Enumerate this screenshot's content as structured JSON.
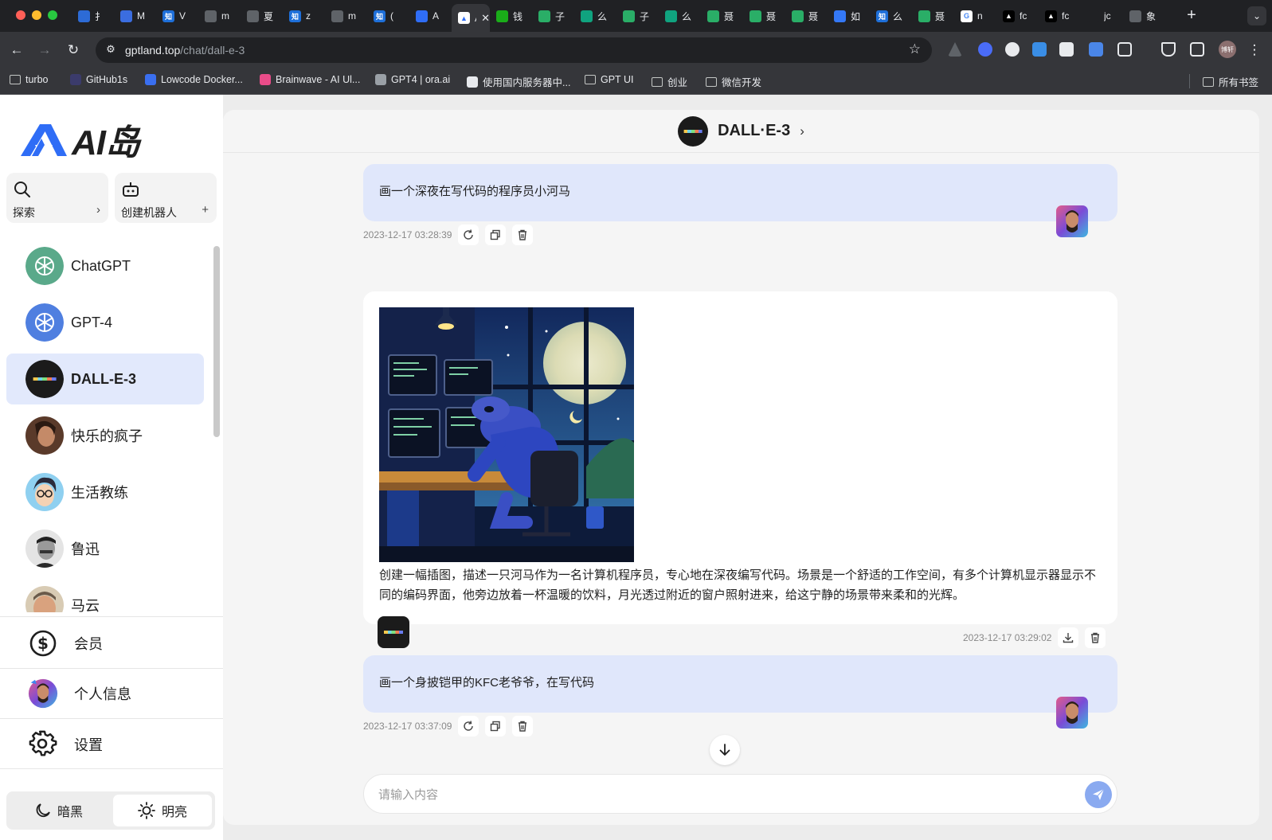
{
  "browser": {
    "tabs": [
      {
        "title": "扌",
        "color": "#2d6bd6",
        "glyph": ""
      },
      {
        "title": "M",
        "color": "#3b6de0",
        "glyph": ""
      },
      {
        "title": "V",
        "color": "#1e6fd9",
        "glyph": "知"
      },
      {
        "title": "m",
        "color": "#5f6368",
        "glyph": ""
      },
      {
        "title": "夏",
        "color": "#5f6368",
        "glyph": ""
      },
      {
        "title": "z",
        "color": "#1e6fd9",
        "glyph": "知"
      },
      {
        "title": "m",
        "color": "#5f6368",
        "glyph": ""
      },
      {
        "title": "(",
        "color": "#1e6fd9",
        "glyph": "知"
      },
      {
        "title": "A",
        "color": "#2f6df6",
        "glyph": ""
      }
    ],
    "active_tab": {
      "title": "A",
      "close": "✕"
    },
    "tabs_right": [
      {
        "title": "钱",
        "color": "#1aad19",
        "glyph": ""
      },
      {
        "title": "子",
        "color": "#2aae67",
        "glyph": ""
      },
      {
        "title": "么",
        "color": "#10a37f",
        "glyph": ""
      },
      {
        "title": "子",
        "color": "#2aae67",
        "glyph": ""
      },
      {
        "title": "么",
        "color": "#10a37f",
        "glyph": ""
      },
      {
        "title": "聂",
        "color": "#2aae67",
        "glyph": ""
      },
      {
        "title": "聂",
        "color": "#2aae67",
        "glyph": ""
      },
      {
        "title": "聂",
        "color": "#2aae67",
        "glyph": ""
      },
      {
        "title": "如",
        "color": "#3478f6",
        "glyph": ""
      },
      {
        "title": "么",
        "color": "#1e6fd9",
        "glyph": "知"
      },
      {
        "title": "聂",
        "color": "#2aae67",
        "glyph": ""
      },
      {
        "title": "n",
        "color": "#ffffff",
        "glyph": "G"
      },
      {
        "title": "fc",
        "color": "#000000",
        "glyph": "▲"
      },
      {
        "title": "fc",
        "color": "#000000",
        "glyph": "▲"
      },
      {
        "title": "jc",
        "color": "#202124",
        "glyph": ""
      },
      {
        "title": "象",
        "color": "#5f6368",
        "glyph": ""
      }
    ],
    "new_tab": "+",
    "url_host": "gptland.top",
    "url_path": "/chat/dall-e-3",
    "profile_label": "博轩",
    "bookmarks": [
      {
        "label": "turbo",
        "type": "folder"
      },
      {
        "label": "GitHub1s",
        "type": "site",
        "color": "#3b3b6b"
      },
      {
        "label": "Lowcode Docker...",
        "type": "site",
        "color": "#3a6ff0"
      },
      {
        "label": "Brainwave - AI Ul...",
        "type": "site",
        "color": "#e94c89"
      },
      {
        "label": "GPT4 | ora.ai",
        "type": "site",
        "color": "#9aa0a6"
      },
      {
        "label": "使用国内服务器中...",
        "type": "site",
        "color": "#e8eaed"
      },
      {
        "label": "GPT UI",
        "type": "folder"
      },
      {
        "label": "创业",
        "type": "folder"
      },
      {
        "label": "微信开发",
        "type": "folder"
      }
    ],
    "all_bookmarks": "所有书签"
  },
  "sidebar": {
    "brand": "AI岛",
    "explore": {
      "label": "探索",
      "arrow": "›"
    },
    "create": {
      "label": "创建机器人",
      "plus": "+"
    },
    "bots": [
      {
        "name": "ChatGPT",
        "avatar": "openai-green"
      },
      {
        "name": "GPT-4",
        "avatar": "openai-blue"
      },
      {
        "name": "DALL-E-3",
        "avatar": "dalle",
        "active": true
      },
      {
        "name": "快乐的疯子",
        "avatar": "portrait"
      },
      {
        "name": "生活教练",
        "avatar": "cartoon"
      },
      {
        "name": "鲁迅",
        "avatar": "bw-portrait"
      },
      {
        "name": "马云",
        "avatar": "portrait-2"
      }
    ],
    "menu": [
      {
        "label": "会员",
        "icon": "dollar-icon"
      },
      {
        "label": "个人信息",
        "icon": "user-avatar"
      },
      {
        "label": "设置",
        "icon": "gear-icon"
      }
    ],
    "theme": {
      "dark": "暗黑",
      "light": "明亮",
      "selected": "light"
    }
  },
  "chat": {
    "title": "DALL·E-3",
    "messages": [
      {
        "role": "user",
        "text": "画一个深夜在写代码的程序员小河马",
        "time": "2023-12-17 03:28:39"
      },
      {
        "role": "bot",
        "text": "创建一幅插图，描述一只河马作为一名计算机程序员，专心地在深夜编写代码。场景是一个舒适的工作空间，有多个计算机显示器显示不同的编码界面，他旁边放着一杯温暖的饮料，月光透过附近的窗户照射进来，给这宁静的场景带来柔和的光辉。",
        "time": "2023-12-17 03:29:02"
      },
      {
        "role": "user",
        "text": "画一个身披铠甲的KFC老爷爷，在写代码",
        "time": "2023-12-17 03:37:09"
      }
    ],
    "input_placeholder": "请输入内容"
  },
  "colors": {
    "accent": "#2f6df6",
    "active_bot_bg": "#e2e9fc",
    "user_bubble": "#e0e7fb",
    "send_button": "#8aaaf0"
  }
}
